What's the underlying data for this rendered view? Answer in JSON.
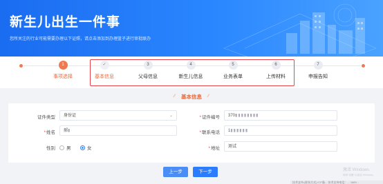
{
  "banner": {
    "title": "新生儿出生一件事",
    "subtitle": "您所关注的行业可能需要办理以下证照，请点击添加到办理篮子进行审批联办"
  },
  "steps": [
    {
      "num": "1",
      "label": "事项选择",
      "state": "active"
    },
    {
      "num": "✓",
      "label": "基本信息",
      "state": "done"
    },
    {
      "num": "3",
      "label": "父母信息",
      "state": "todo"
    },
    {
      "num": "4",
      "label": "新生儿信息",
      "state": "todo"
    },
    {
      "num": "5",
      "label": "业务表单",
      "state": "todo"
    },
    {
      "num": "6",
      "label": "上传材料",
      "state": "todo"
    },
    {
      "num": "7",
      "label": "申报告知",
      "state": "todo"
    }
  ],
  "section": {
    "title": "基本信息"
  },
  "form": {
    "id_type": {
      "label": "证件类型",
      "value": "身份证"
    },
    "id_number": {
      "label": "证件编号",
      "value": "370"
    },
    "name": {
      "label": "姓名",
      "value": "郝"
    },
    "phone": {
      "label": "联系电话",
      "value": "1"
    },
    "gender": {
      "label": "性别",
      "option_male": "男",
      "option_female": "女",
      "selected": "女"
    },
    "address": {
      "label": "地址",
      "value": "测试"
    }
  },
  "buttons": {
    "prev": "上一步",
    "next": "下一步"
  },
  "watermark": {
    "line1": "激活 Windows",
    "line2": "转到\"设置\"以激活 Windows。"
  },
  "footer": {
    "text": "技术支持:|联系方式| ICP备... 技术支持电话：... 1889..."
  },
  "colors": {
    "brand_blue": "#2b7cff",
    "accent_orange": "#f07a4f",
    "highlight_red": "#e8424a"
  }
}
